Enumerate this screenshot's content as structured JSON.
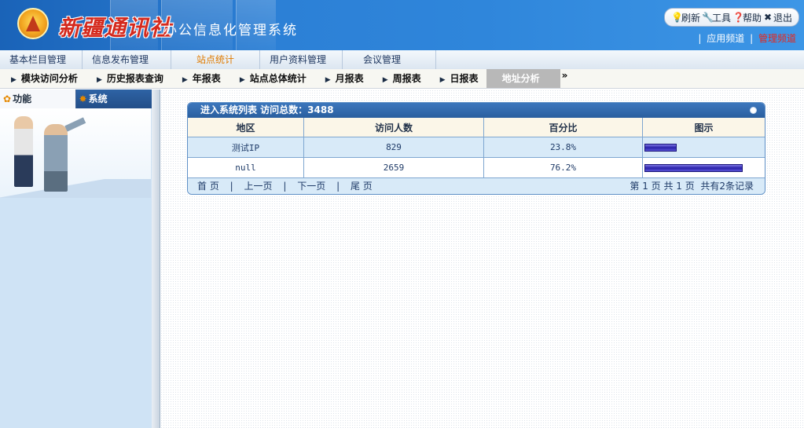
{
  "header": {
    "brand_text": "新疆通讯社",
    "system_title": "办公信息化管理系统",
    "toolbar": [
      {
        "label": "刷新",
        "icon": "bulb-icon"
      },
      {
        "label": "工具",
        "icon": "wrench-icon"
      },
      {
        "label": "帮助",
        "icon": "help-icon"
      },
      {
        "label": "退出",
        "icon": "close-icon"
      }
    ],
    "channels": {
      "app": "应用频道",
      "manage": "管理频道",
      "separator": "|"
    }
  },
  "main_menu": [
    {
      "label": "基本栏目管理",
      "active": false
    },
    {
      "label": "信息发布管理",
      "active": false
    },
    {
      "label": "站点统计",
      "active": true
    },
    {
      "label": "用户资料管理",
      "active": false
    },
    {
      "label": "会议管理",
      "active": false
    }
  ],
  "sub_menu": [
    {
      "label": "模块访问分析",
      "active": false
    },
    {
      "label": "历史报表查询",
      "active": false
    },
    {
      "label": "年报表",
      "active": false
    },
    {
      "label": "站点总体统计",
      "active": false
    },
    {
      "label": "月报表",
      "active": false
    },
    {
      "label": "周报表",
      "active": false
    },
    {
      "label": "日报表",
      "active": false
    },
    {
      "label": "地址分析",
      "active": true
    }
  ],
  "sub_menu_more": "»",
  "sidebar": {
    "tab_function": "功能",
    "tab_system": "系统"
  },
  "panel": {
    "title": "进入系统列表  访问总数：3488",
    "columns": [
      "地区",
      "访问人数",
      "百分比",
      "图示"
    ],
    "rows": [
      {
        "region": "测试IP",
        "visits": "829",
        "percent": "23.8%",
        "ratio": 0.238
      },
      {
        "region": "null",
        "visits": "2659",
        "percent": "76.2%",
        "ratio": 0.762
      }
    ],
    "pager": {
      "first": "首 页",
      "prev": "上一页",
      "next": "下一页",
      "last": "尾 页",
      "separator": "|",
      "status": "第 1 页 共 1 页  共有2条记录"
    }
  },
  "colors": {
    "header_blue": "#2c80d6",
    "menu_active": "#e07b00",
    "channel_active": "#e8261a",
    "bar": "#2a21a8"
  }
}
